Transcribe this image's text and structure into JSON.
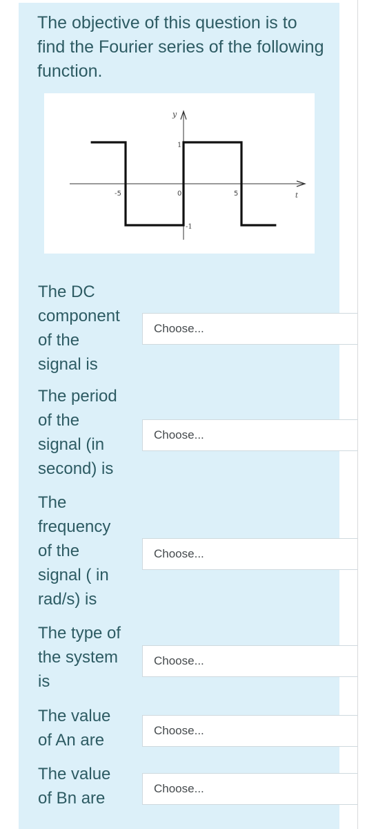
{
  "question": {
    "intro_text": "The objective of this question is to find the Fourier series of the following function."
  },
  "graph": {
    "y_axis_label": "y",
    "x_axis_label": "t",
    "tick_labels": {
      "x_neg5": "-5",
      "x_0": "0",
      "x_5": "5",
      "y_1": "1",
      "y_neg1": "-1"
    },
    "function": {
      "type": "square-wave",
      "amplitude": 1,
      "segments": [
        {
          "t_start": -8,
          "t_end": -5,
          "value": 1
        },
        {
          "t_start": -5,
          "t_end": 0,
          "value": -1
        },
        {
          "t_start": 0,
          "t_end": 5,
          "value": 1
        },
        {
          "t_start": 5,
          "t_end": 8,
          "value": -1
        }
      ]
    }
  },
  "rows": [
    {
      "label": "The DC component of the signal is",
      "label_lines": [
        "The DC",
        "component",
        "of the",
        "signal is"
      ],
      "select_value": "Choose..."
    },
    {
      "label": "The period of the signal (in second) is",
      "label_lines": [
        "The period",
        "of the",
        "signal (in",
        "second) is"
      ],
      "select_value": "Choose..."
    },
    {
      "label": "The frequency of the signal ( in rad/s) is",
      "label_lines": [
        "The",
        "frequency",
        "of the",
        "signal ( in",
        "rad/s) is"
      ],
      "select_value": "Choose..."
    },
    {
      "label": "The type of the system is",
      "label_lines": [
        "The type of",
        "the system",
        "is"
      ],
      "select_value": "Choose..."
    },
    {
      "label": "The value of An are",
      "label_lines": [
        "The value",
        "of An are"
      ],
      "select_value": "Choose..."
    },
    {
      "label": "The value of Bn are",
      "label_lines": [
        "The value",
        "of Bn are"
      ],
      "select_value": "Choose..."
    }
  ],
  "colors": {
    "panel_background": "#dcf0f9",
    "text": "#2d5b63",
    "select_text": "#454a4d"
  }
}
